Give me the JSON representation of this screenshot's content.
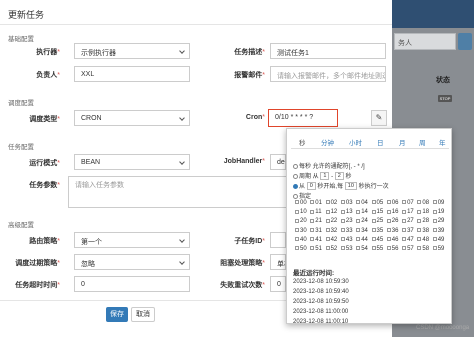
{
  "modal": {
    "title": "更新任务",
    "sections": {
      "basic": "基础配置",
      "schedule": "调度配置",
      "task": "任务配置",
      "advanced": "高级配置"
    },
    "fields": {
      "executor": {
        "label": "执行器",
        "value": "示例执行器"
      },
      "task_desc": {
        "label": "任务描述",
        "value": "测试任务1"
      },
      "owner": {
        "label": "负责人",
        "value": "XXL"
      },
      "alarm_email": {
        "label": "报警邮件",
        "placeholder": "请输入报警邮件，多个邮件地址则逗号分"
      },
      "schedule_type": {
        "label": "调度类型",
        "value": "CRON"
      },
      "cron": {
        "label": "Cron",
        "value": "0/10 * * * * ?"
      },
      "run_mode": {
        "label": "运行模式",
        "value": "BEAN"
      },
      "job_handler": {
        "label": "JobHandler",
        "value": "dem"
      },
      "task_params": {
        "label": "任务参数",
        "placeholder": "请输入任务参数"
      },
      "route_strategy": {
        "label": "路由策略",
        "value": "第一个"
      },
      "child_task": {
        "label": "子任务ID"
      },
      "misfire_strategy": {
        "label": "调度过期策略",
        "value": "忽略"
      },
      "block_strategy": {
        "label": "阻塞处理策略",
        "value": "单机"
      },
      "timeout": {
        "label": "任务超时时间",
        "value": "0"
      },
      "retry": {
        "label": "失败重试次数",
        "value": "0"
      }
    },
    "buttons": {
      "save": "保存",
      "cancel": "取消"
    }
  },
  "cron_popup": {
    "tabs": [
      "秒",
      "分钟",
      "小时",
      "日",
      "月",
      "周",
      "年"
    ],
    "opt_every": "每秒 允许的通配符[, - * /]",
    "opt_cycle": {
      "prefix": "周期 从",
      "from": "1",
      "dash": "-",
      "to": "2",
      "suffix": "秒"
    },
    "opt_from": {
      "prefix": "从",
      "start": "0",
      "mid": "秒开始,每",
      "step": "10",
      "suffix": "秒执行一次"
    },
    "opt_specify": "指定",
    "seconds": [
      "00",
      "01",
      "02",
      "03",
      "04",
      "05",
      "06",
      "07",
      "08",
      "09",
      "10",
      "11",
      "12",
      "13",
      "14",
      "15",
      "16",
      "17",
      "18",
      "19",
      "20",
      "21",
      "22",
      "23",
      "24",
      "25",
      "26",
      "27",
      "28",
      "29",
      "30",
      "31",
      "32",
      "33",
      "34",
      "35",
      "36",
      "37",
      "38",
      "39",
      "40",
      "41",
      "42",
      "43",
      "44",
      "45",
      "46",
      "47",
      "48",
      "49",
      "50",
      "51",
      "52",
      "53",
      "54",
      "55",
      "56",
      "57",
      "58",
      "59"
    ],
    "recent_title": "最近运行时间:",
    "recent": [
      "2023-12-08 10:59:30",
      "2023-12-08 10:59:40",
      "2023-12-08 10:59:50",
      "2023-12-08 11:00:00",
      "2023-12-08 11:00:10"
    ]
  },
  "background": {
    "search_text": "务人",
    "status_header": "状态",
    "status_badge": "STOP",
    "watermark": "CSDN @moooonga"
  }
}
